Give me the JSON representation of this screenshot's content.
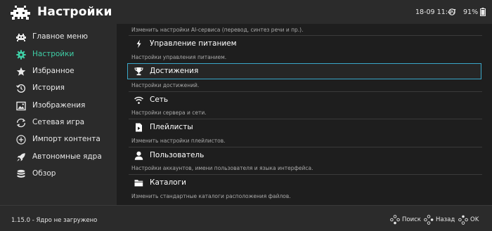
{
  "header": {
    "title": "Настройки",
    "clock": "18-09 11:47",
    "battery": "91%"
  },
  "sidebar": {
    "items": [
      {
        "label": "Главное меню",
        "icon": "invader-icon",
        "active": false
      },
      {
        "label": "Настройки",
        "icon": "gear-icon",
        "active": true
      },
      {
        "label": "Избранное",
        "icon": "star-icon",
        "active": false
      },
      {
        "label": "История",
        "icon": "history-icon",
        "active": false
      },
      {
        "label": "Изображения",
        "icon": "image-icon",
        "active": false
      },
      {
        "label": "Сетевая игра",
        "icon": "netplay-icon",
        "active": false
      },
      {
        "label": "Импорт контента",
        "icon": "plus-circle-icon",
        "active": false
      },
      {
        "label": "Автономные ядра",
        "icon": "rocket-icon",
        "active": false
      },
      {
        "label": "Обзор",
        "icon": "database-icon",
        "active": false
      }
    ]
  },
  "settings": {
    "top_description": "Изменить настройки AI-сервиса (перевод, синтез речи и пр.).",
    "items": [
      {
        "label": "Управление питанием",
        "description": "Настройки управления питанием.",
        "icon": "lightning-icon"
      },
      {
        "label": "Достижения",
        "description": "Настройки достижений.",
        "icon": "trophy-icon",
        "selected": true
      },
      {
        "label": "Сеть",
        "description": "Настройки сервера и сети.",
        "icon": "wifi-icon"
      },
      {
        "label": "Плейлисты",
        "description": "Изменить настройки плейлистов.",
        "icon": "playlist-icon"
      },
      {
        "label": "Пользователь",
        "description": "Настройки аккаунтов, имени пользователя и языка интерфейса.",
        "icon": "user-icon"
      },
      {
        "label": "Каталоги",
        "description": "Изменить стандартные каталоги расположения файлов.",
        "icon": "folder-icon"
      }
    ]
  },
  "footer": {
    "version": "1.15.0 - Ядро не загружено",
    "search": "Поиск",
    "back": "Назад",
    "ok": "OK"
  },
  "colors": {
    "accent": "#3fd0a7",
    "selection_border": "#3aa7c9",
    "panel": "#2b2b2b",
    "background": "#1e1e1e"
  }
}
